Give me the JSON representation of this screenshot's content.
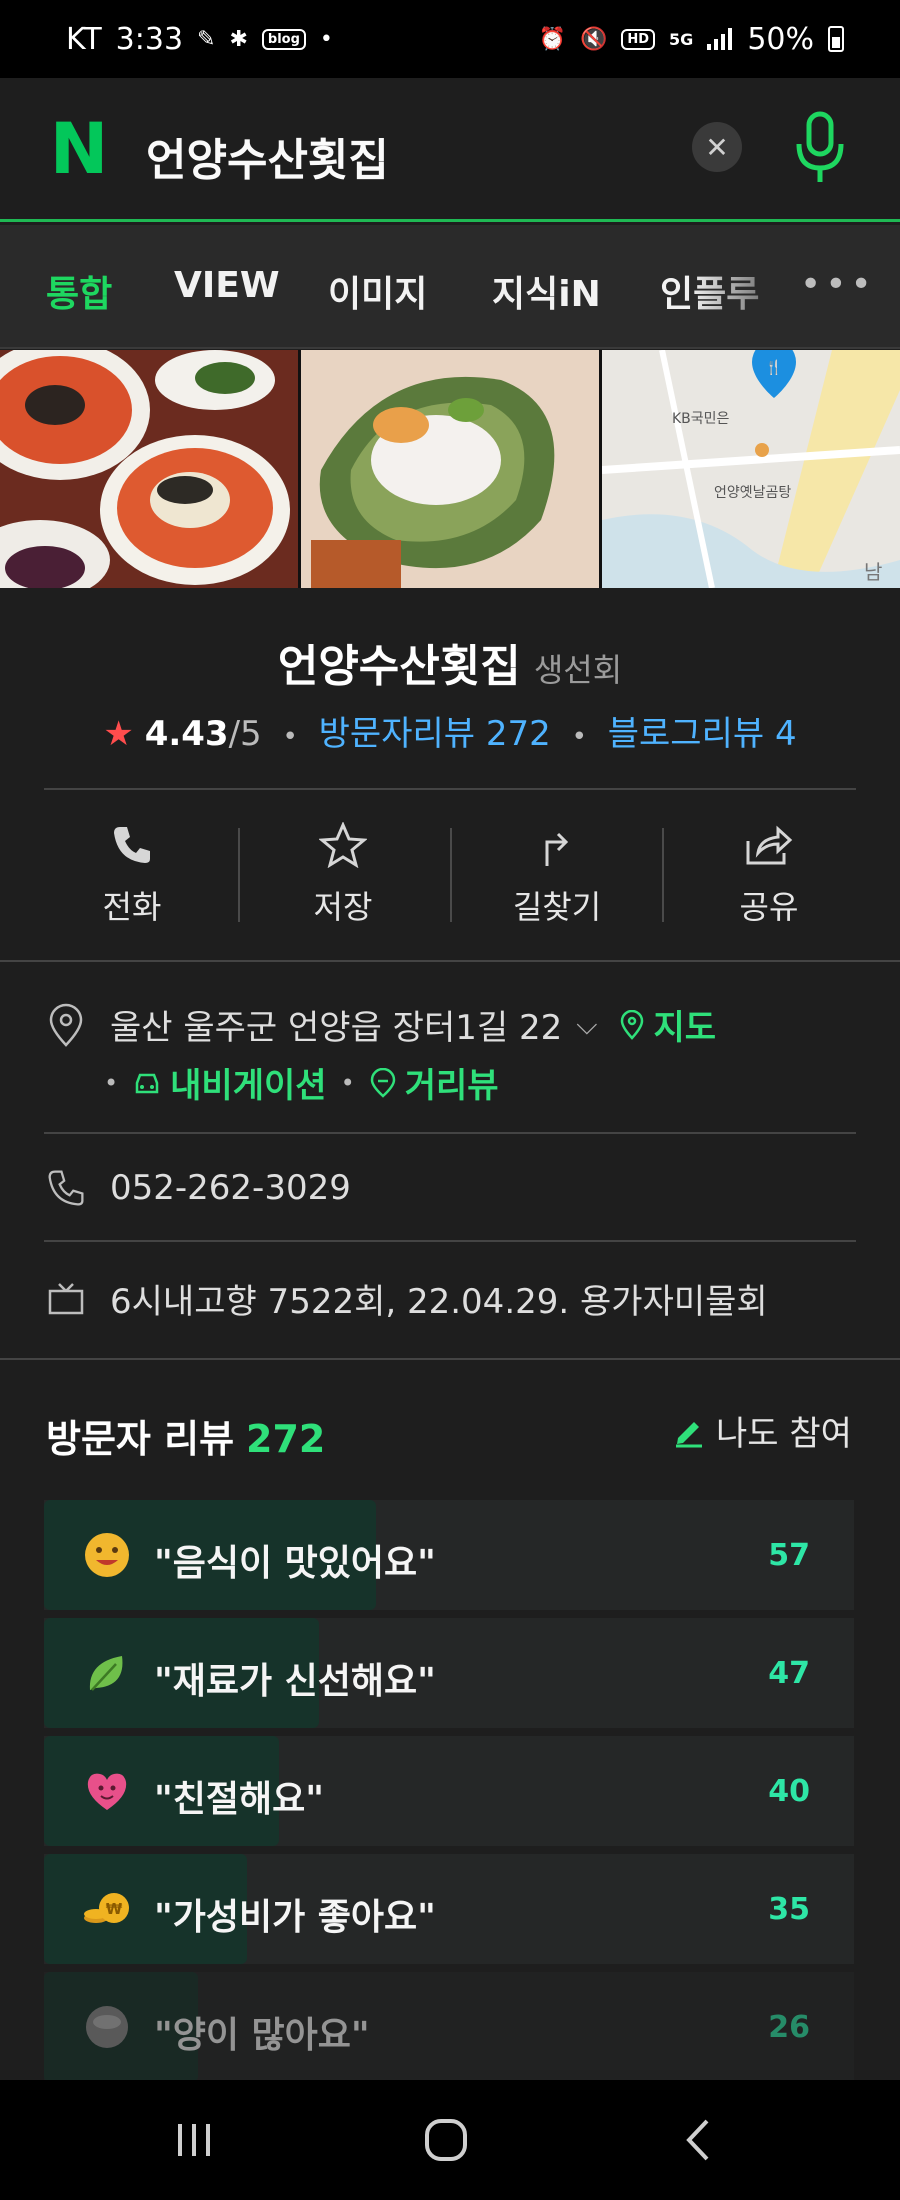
{
  "status_bar": {
    "carrier": "KT",
    "time": "3:33",
    "blog_badge": "blog",
    "battery": "50%",
    "network": "5G"
  },
  "search": {
    "logo": "N",
    "query": "언양수산횟집",
    "clear_icon": "close-icon",
    "mic_icon": "mic-icon"
  },
  "tabs": [
    {
      "label": "통합",
      "active": true
    },
    {
      "label": "VIEW"
    },
    {
      "label": "이미지"
    },
    {
      "label": "지식iN"
    },
    {
      "label": "인플루"
    }
  ],
  "more_label": "•••",
  "map": {
    "bank_label": "KB국민은",
    "store_label": "언양옛날곰탕",
    "edge_label": "남부"
  },
  "place": {
    "name": "언양수산횟집",
    "category": "생선회",
    "rating": "4.43",
    "rating_max": "/5",
    "visitor_reviews": "방문자리뷰 272",
    "blog_reviews": "블로그리뷰 4"
  },
  "actions": [
    {
      "label": "전화",
      "icon": "phone-icon"
    },
    {
      "label": "저장",
      "icon": "star-outline-icon"
    },
    {
      "label": "길찾기",
      "icon": "directions-icon"
    },
    {
      "label": "공유",
      "icon": "share-icon"
    }
  ],
  "info": {
    "address": "울산 울주군 언양읍 장터1길 22",
    "map_link": "지도",
    "navigation_link": "내비게이션",
    "street_view_link": "거리뷰",
    "phone": "052-262-3029",
    "tv": "6시내고향 7522회, 22.04.29. 용가자미물회"
  },
  "reviews": {
    "title": "방문자 리뷰",
    "count": "272",
    "join_label": "나도 참여",
    "items": [
      {
        "text": "\"음식이 맛있어요\"",
        "count": 57,
        "share": 0.41,
        "emoji": "yummy-face-icon",
        "color": "#f1b72e"
      },
      {
        "text": "\"재료가 신선해요\"",
        "count": 47,
        "share": 0.34,
        "emoji": "leaf-icon",
        "color": "#6fbf4a"
      },
      {
        "text": "\"친절해요\"",
        "count": 40,
        "share": 0.29,
        "emoji": "heart-face-icon",
        "color": "#e8508a"
      },
      {
        "text": "\"가성비가 좋아요\"",
        "count": 35,
        "share": 0.25,
        "emoji": "coins-icon",
        "color": "#f0b321"
      },
      {
        "text": "\"양이 많아요\"",
        "count": 26,
        "share": 0.19,
        "emoji": "bowl-icon",
        "color": "#8a8a8a"
      }
    ]
  }
}
